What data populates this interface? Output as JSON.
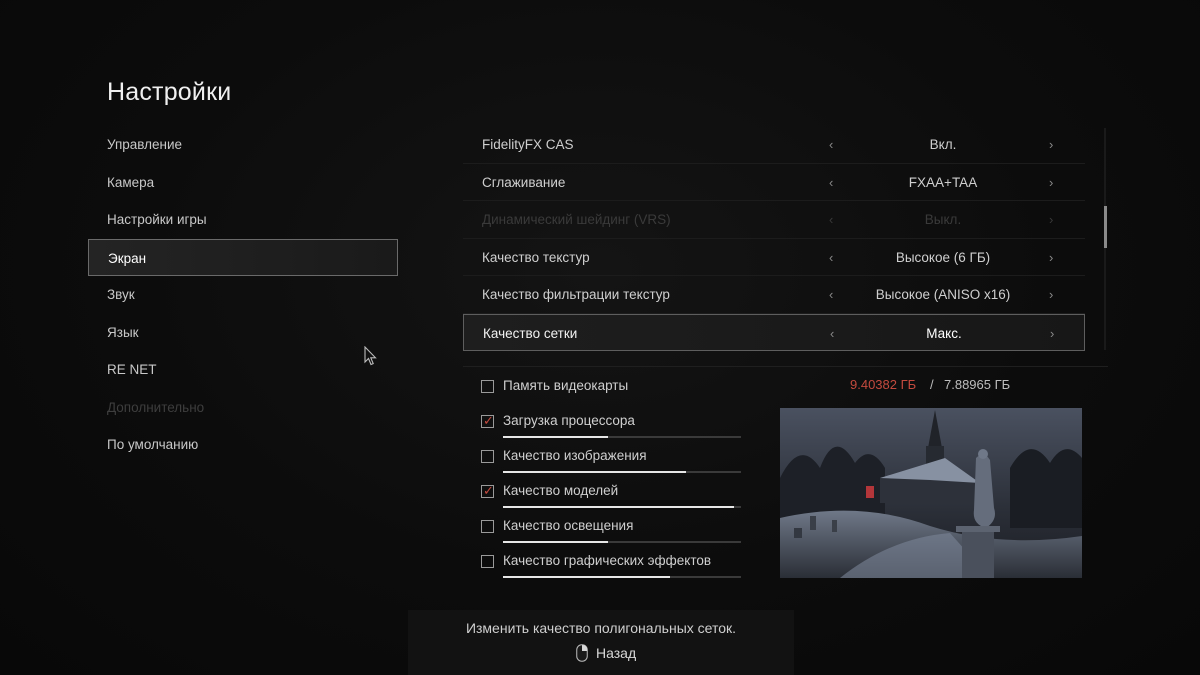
{
  "page": {
    "title": "Настройки"
  },
  "menu": {
    "items": [
      {
        "label": "Управление",
        "state": "normal"
      },
      {
        "label": "Камера",
        "state": "normal"
      },
      {
        "label": "Настройки игры",
        "state": "normal"
      },
      {
        "label": "Экран",
        "state": "selected"
      },
      {
        "label": "Звук",
        "state": "normal"
      },
      {
        "label": "Язык",
        "state": "normal"
      },
      {
        "label": "RE NET",
        "state": "normal"
      },
      {
        "label": "Дополнительно",
        "state": "disabled"
      },
      {
        "label": "По умолчанию",
        "state": "normal"
      }
    ]
  },
  "settings": {
    "rows": [
      {
        "label": "FidelityFX CAS",
        "value": "Вкл.",
        "state": "normal"
      },
      {
        "label": "Сглаживание",
        "value": "FXAA+TAA",
        "state": "normal"
      },
      {
        "label": "Динамический шейдинг (VRS)",
        "value": "Выкл.",
        "state": "disabled"
      },
      {
        "label": "Качество текстур",
        "value": "Высокое (6 ГБ)",
        "state": "normal"
      },
      {
        "label": "Качество фильтрации текстур",
        "value": "Высокое (ANISO x16)",
        "state": "normal"
      },
      {
        "label": "Качество сетки",
        "value": "Макс.",
        "state": "selected"
      }
    ],
    "arrow_left": "‹",
    "arrow_right": "›"
  },
  "vram": {
    "label": "Память видеокарты",
    "used": "9.40382 ГБ",
    "separator": "/",
    "total": "7.88965 ГБ",
    "checked": false
  },
  "checks": [
    {
      "label": "Загрузка процессора",
      "checked": true,
      "bar_fraction": 0.44
    },
    {
      "label": "Качество изображения",
      "checked": false,
      "bar_fraction": 0.77
    },
    {
      "label": "Качество моделей",
      "checked": true,
      "bar_fraction": 0.97
    },
    {
      "label": "Качество освещения",
      "checked": false,
      "bar_fraction": 0.44
    },
    {
      "label": "Качество графических эффектов",
      "checked": false,
      "bar_fraction": 0.7
    }
  ],
  "footer": {
    "hint": "Изменить качество полигональных сеток.",
    "back_label": "Назад"
  },
  "colors": {
    "accent_red": "#c44a3e",
    "text": "#cfcfcf",
    "disabled": "#3a3a3a"
  }
}
